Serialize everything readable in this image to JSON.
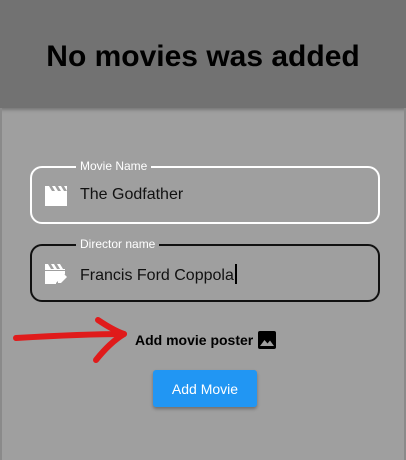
{
  "app_bar": {
    "title": "No movies was added"
  },
  "form": {
    "movie_name": {
      "label": "Movie Name",
      "value": "The Godfather",
      "icon": "movie-clapper-icon"
    },
    "director_name": {
      "label": "Director name",
      "value": "Francis Ford Coppola",
      "icon": "movie-edit-icon"
    },
    "poster": {
      "label": "Add movie poster",
      "icon": "image-icon"
    },
    "submit_label": "Add Movie"
  },
  "colors": {
    "background": "#9f9f9f",
    "app_bar": "#727272",
    "button": "#2196f3",
    "annotation_arrow": "#e01b1b"
  }
}
